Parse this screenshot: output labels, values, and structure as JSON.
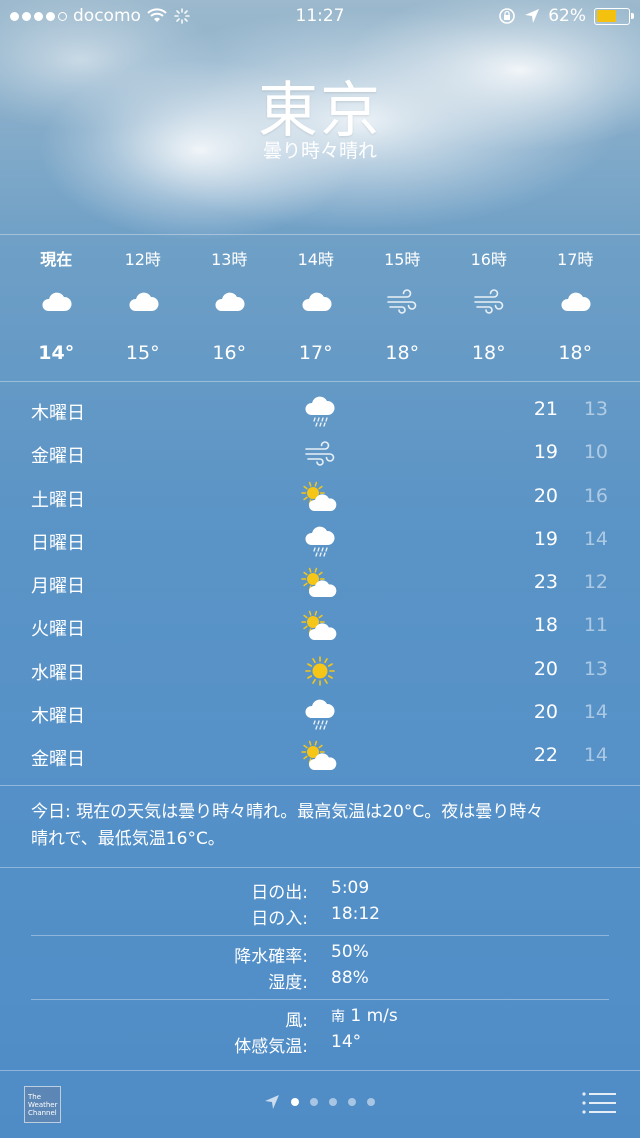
{
  "status_bar": {
    "carrier": "docomo",
    "time": "11:27",
    "battery": "62%",
    "battery_fraction": 0.62
  },
  "location": {
    "city": "東京",
    "condition": "曇り時々晴れ"
  },
  "hourly": [
    {
      "label": "現在",
      "icon": "cloud-icon",
      "temp": "14°"
    },
    {
      "label": "12時",
      "icon": "cloud-icon",
      "temp": "15°"
    },
    {
      "label": "13時",
      "icon": "cloud-icon",
      "temp": "16°"
    },
    {
      "label": "14時",
      "icon": "cloud-icon",
      "temp": "17°"
    },
    {
      "label": "15時",
      "icon": "wind-icon",
      "temp": "18°"
    },
    {
      "label": "16時",
      "icon": "wind-icon",
      "temp": "18°"
    },
    {
      "label": "17時",
      "icon": "cloud-icon",
      "temp": "18°"
    }
  ],
  "daily": [
    {
      "day": "木曜日",
      "icon": "rain-icon",
      "high": "21",
      "low": "13"
    },
    {
      "day": "金曜日",
      "icon": "wind-icon",
      "high": "19",
      "low": "10"
    },
    {
      "day": "土曜日",
      "icon": "partly-cloudy-icon",
      "high": "20",
      "low": "16"
    },
    {
      "day": "日曜日",
      "icon": "rain-icon",
      "high": "19",
      "low": "14"
    },
    {
      "day": "月曜日",
      "icon": "partly-cloudy-icon",
      "high": "23",
      "low": "12"
    },
    {
      "day": "火曜日",
      "icon": "partly-cloudy-icon",
      "high": "18",
      "low": "11"
    },
    {
      "day": "水曜日",
      "icon": "sun-icon",
      "high": "20",
      "low": "13"
    },
    {
      "day": "木曜日",
      "icon": "rain-icon",
      "high": "20",
      "low": "14"
    },
    {
      "day": "金曜日",
      "icon": "partly-cloudy-icon",
      "high": "22",
      "low": "14"
    }
  ],
  "summary": {
    "line1": "今日: 現在の天気は曇り時々晴れ。最高気温は20°C。夜は曇り時々",
    "line2": "晴れで、最低気温16°C。"
  },
  "details": {
    "sunrise_label": "日の出:",
    "sunrise": "5:09",
    "sunset_label": "日の入:",
    "sunset": "18:12",
    "rain_label": "降水確率:",
    "rain": "50%",
    "humidity_label": "湿度:",
    "humidity": "88%",
    "wind_label": "風:",
    "wind_dir": "南",
    "wind_speed": "1 m/s",
    "feels_label": "体感気温:",
    "feels": "14°"
  },
  "footer": {
    "logo_line1": "The",
    "logo_line2": "Weather",
    "logo_line3": "Channel",
    "page_count": 5,
    "current_page": 0
  },
  "colors": {
    "sun": "#f5c518",
    "battery": "#f4c10f",
    "cloud": "#ffffff"
  }
}
